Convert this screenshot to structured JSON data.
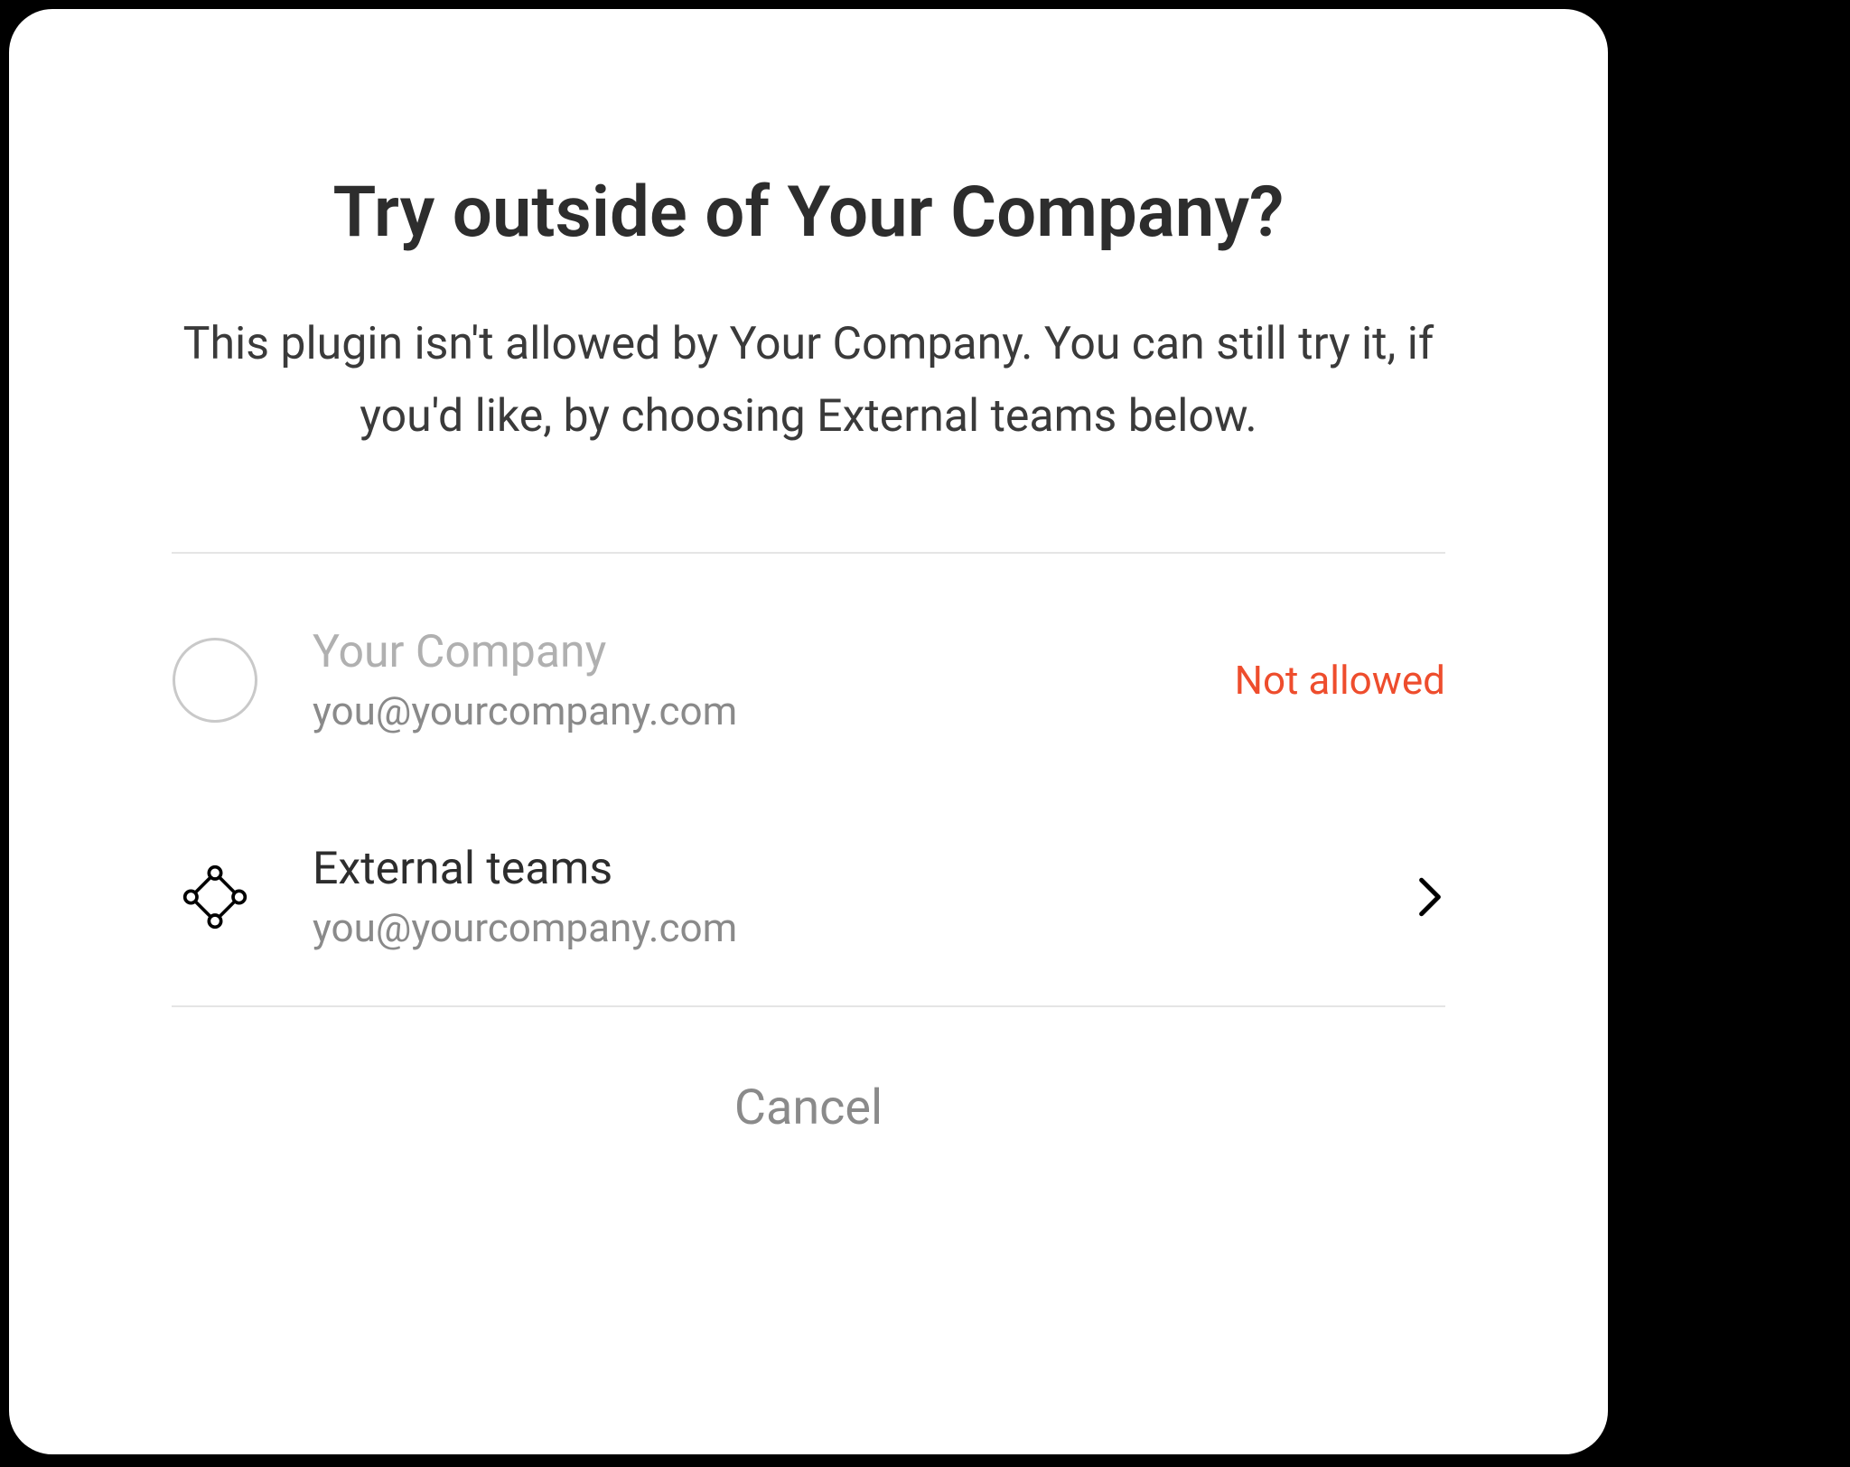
{
  "dialog": {
    "title": "Try outside of Your Company?",
    "description": "This plugin isn't allowed by Your Company. You can still try it, if you'd like, by choosing External teams below."
  },
  "options": {
    "company": {
      "name": "Your Company",
      "email": "you@yourcompany.com",
      "status": "Not allowed"
    },
    "external": {
      "name": "External teams",
      "email": "you@yourcompany.com"
    }
  },
  "footer": {
    "cancel": "Cancel"
  },
  "colors": {
    "warning": "#ee4d2d"
  }
}
